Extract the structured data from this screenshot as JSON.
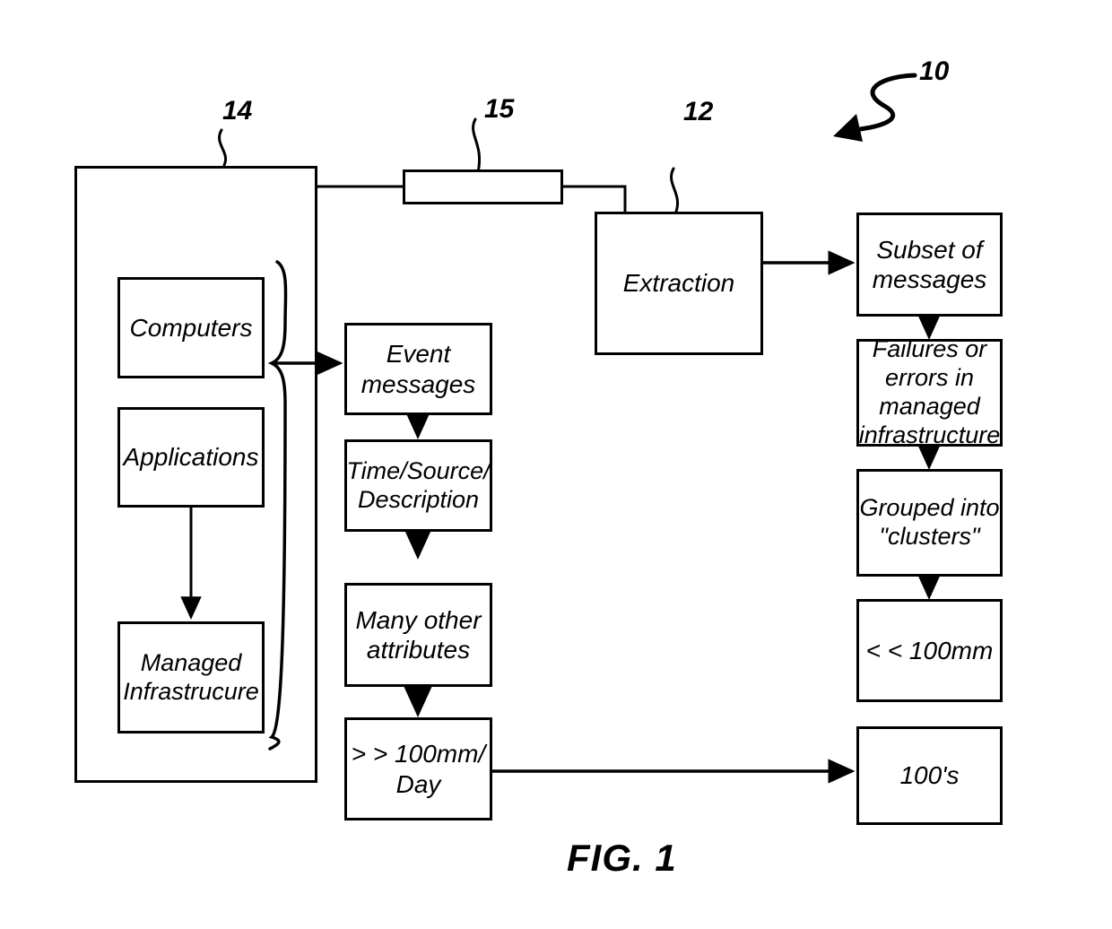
{
  "figure": {
    "caption": "FIG. 1",
    "reference_numerals": {
      "system": "10",
      "extraction": "12",
      "managed_environment": "14",
      "network_link": "15"
    }
  },
  "managed_environment": {
    "ref": "14",
    "items": [
      {
        "id": "computers",
        "label": "Computers"
      },
      {
        "id": "applications",
        "label": "Applications"
      },
      {
        "id": "managed-infrastructure",
        "label": "Managed\nInfrastrucure"
      }
    ]
  },
  "network_link": {
    "ref": "15",
    "label": ""
  },
  "extraction": {
    "ref": "12",
    "label": "Extraction"
  },
  "message_pipeline": {
    "items": [
      {
        "id": "event-messages",
        "label": "Event\nmessages"
      },
      {
        "id": "time-source-description",
        "label": "Time/Source/\nDescription"
      },
      {
        "id": "many-other-attributes",
        "label": "Many other\nattributes"
      },
      {
        "id": "volume-per-day",
        "label": "> > 100mm/\nDay"
      }
    ]
  },
  "analysis_pipeline": {
    "items": [
      {
        "id": "subset-of-messages",
        "label": "Subset of\nmessages"
      },
      {
        "id": "failures-or-errors",
        "label": "Failures or\nerrors in\nmanaged\ninfrastructure"
      },
      {
        "id": "grouped-into-clusters",
        "label": "Grouped into\n\"clusters\""
      },
      {
        "id": "cluster-volume",
        "label": "< < 100mm"
      },
      {
        "id": "hundreds",
        "label": "100's"
      }
    ]
  },
  "colors": {
    "stroke": "#000000",
    "fill": "#ffffff"
  }
}
